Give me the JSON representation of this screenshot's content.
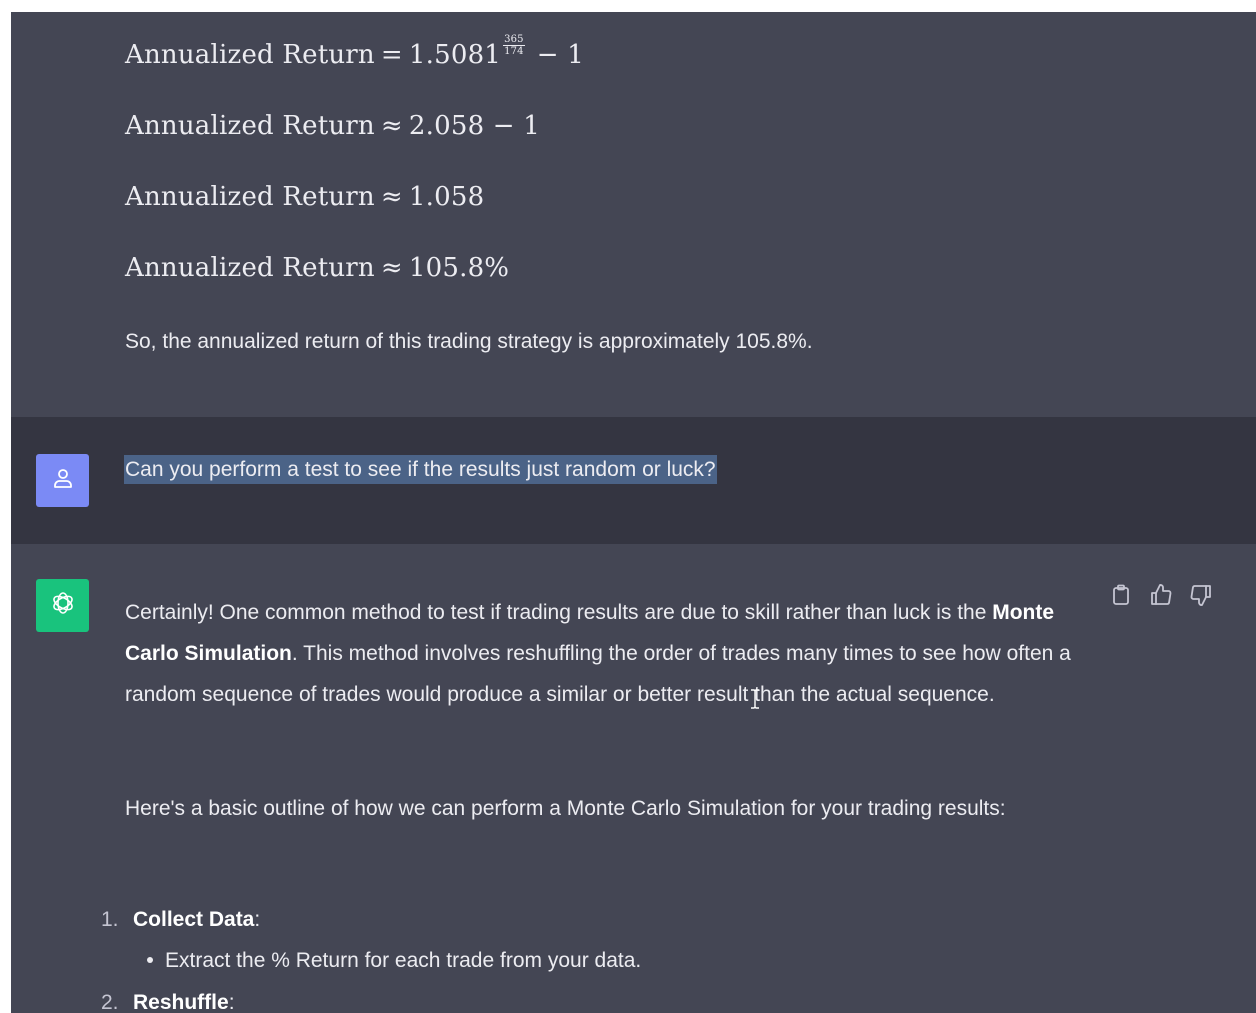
{
  "math": {
    "lines": [
      {
        "lhs": "Annualized Return",
        "rel": "=",
        "rhs": "1.5081",
        "exp_num": "365",
        "exp_den": "174",
        "tail": "− 1"
      },
      {
        "lhs": "Annualized Return",
        "rel": "≈",
        "rhs": "2.058 − 1"
      },
      {
        "lhs": "Annualized Return",
        "rel": "≈",
        "rhs": "1.058"
      },
      {
        "lhs": "Annualized Return",
        "rel": "≈",
        "rhs": "105.8%"
      }
    ],
    "summary": "So, the annualized return of this trading strategy is approximately 105.8%."
  },
  "user_message": {
    "text": "Can you perform a test to see if the results just random or luck?",
    "avatar_icon": "user-icon",
    "avatar_color": "#7b8af5"
  },
  "assistant_message": {
    "avatar_icon": "openai-logo-icon",
    "avatar_color": "#19c37d",
    "para1_part1": "Certainly! One common method to test if trading results are due to skill rather than luck is the ",
    "para1_bold": "Monte Carlo Simulation",
    "para1_part2": ". This method involves reshuffling the order of trades many times to see how often a random sequence of trades would produce a similar or better result than the actual sequence.",
    "para2": "Here's a basic outline of how we can perform a Monte Carlo Simulation for your trading results:",
    "list": [
      {
        "num": "1.",
        "title": "Collect Data",
        "suffix": ":",
        "sub": "Extract the % Return for each trade from your data."
      },
      {
        "num": "2.",
        "title": "Reshuffle",
        "suffix": ":"
      }
    ],
    "actions": [
      "copy-icon",
      "thumbs-up-icon",
      "thumbs-down-icon"
    ]
  },
  "colors": {
    "assistant_bg": "#444654",
    "user_bg": "#343541",
    "text": "#ececf1",
    "selection": "#4b6387"
  }
}
